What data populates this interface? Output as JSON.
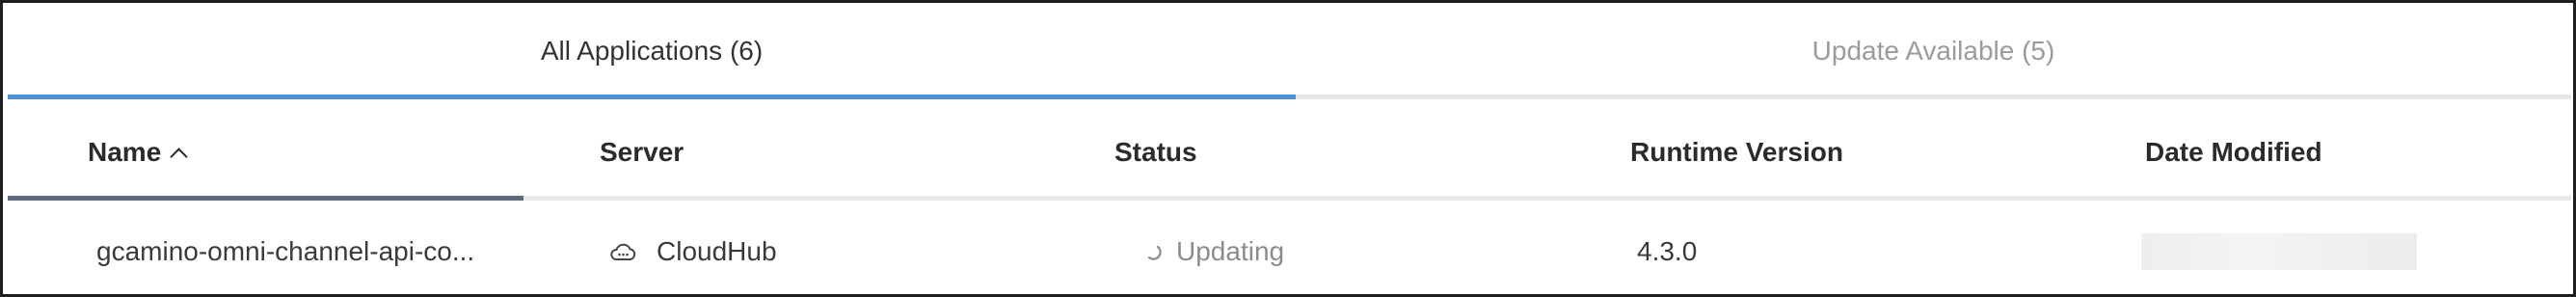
{
  "tabs": [
    {
      "label": "All Applications (6)",
      "active": true
    },
    {
      "label": "Update Available (5)",
      "active": false
    }
  ],
  "columns": {
    "name": "Name",
    "server": "Server",
    "status": "Status",
    "runtime": "Runtime Version",
    "date": "Date Modified"
  },
  "sort": {
    "column": "name",
    "direction": "ascending"
  },
  "rows": [
    {
      "name": "gcamino-omni-channel-api-co...",
      "server": "CloudHub",
      "server_icon": "cloud-icon",
      "status": "Updating",
      "status_icon": "spinner-icon",
      "runtime": "4.3.0",
      "date_modified": ""
    }
  ],
  "colors": {
    "active_tab_indicator": "#4a90d9",
    "inactive_tab_text": "#9b9b9b",
    "sorted_column_indicator": "#5b6b7a"
  }
}
